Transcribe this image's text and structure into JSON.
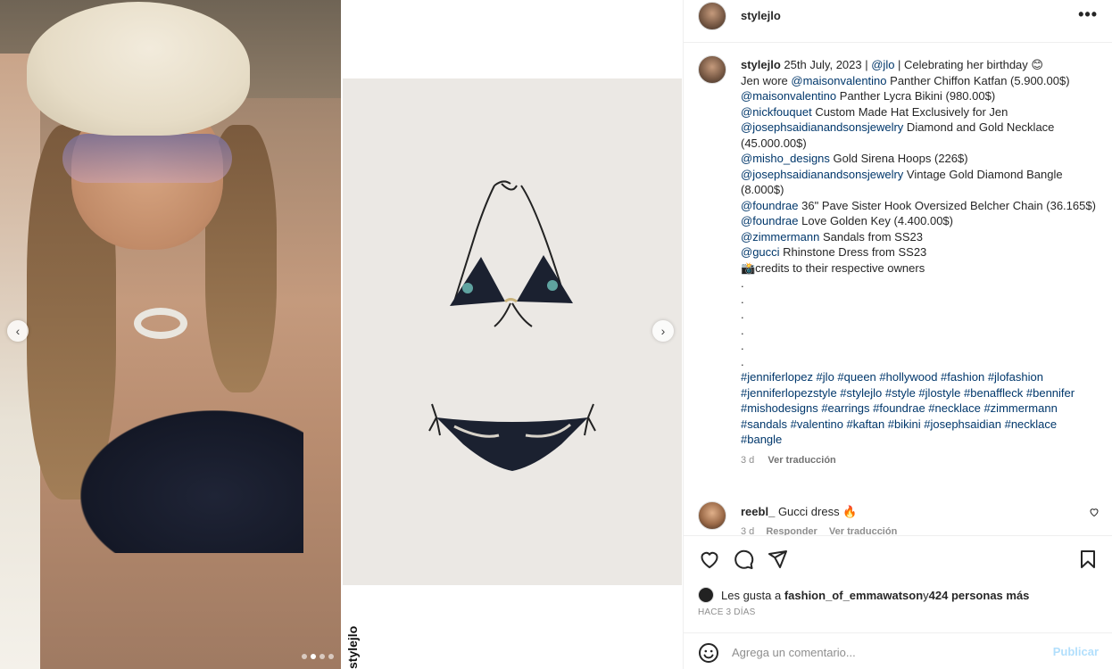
{
  "post": {
    "username": "stylejlo",
    "more_label": "•••"
  },
  "caption": {
    "username": "stylejlo",
    "line1_text": " 25th July, 2023 | ",
    "line1_mention": "@jlo",
    "line1_tail": " | Celebrating her birthday 😊",
    "lines": [
      {
        "prefix": "Jen wore ",
        "mention": "@maisonvalentino",
        "text": " Panther Chiffon Katfan (5.900.00$)"
      },
      {
        "prefix": "",
        "mention": "@maisonvalentino",
        "text": " Panther Lycra Bikini (980.00$)"
      },
      {
        "prefix": "",
        "mention": "@nickfouquet",
        "text": " Custom Made Hat Exclusively for Jen"
      },
      {
        "prefix": "",
        "mention": "@josephsaidianandsonsjewelry",
        "text": " Diamond and Gold Necklace (45.000.00$)"
      },
      {
        "prefix": "",
        "mention": "@misho_designs",
        "text": " Gold Sirena Hoops (226$)"
      },
      {
        "prefix": "",
        "mention": "@josephsaidianandsonsjewelry",
        "text": " Vintage Gold Diamond Bangle (8.000$)"
      },
      {
        "prefix": "",
        "mention": "@foundrae",
        "text": " 36\" Pave Sister Hook Oversized Belcher Chain (36.165$)"
      },
      {
        "prefix": "",
        "mention": "@foundrae",
        "text": " Love Golden Key (4.400.00$)"
      },
      {
        "prefix": "",
        "mention": "@zimmermann",
        "text": " Sandals from SS23"
      },
      {
        "prefix": "",
        "mention": "@gucci",
        "text": " Rhinstone Dress from SS23"
      }
    ],
    "credits": "📸credits to their respective owners",
    "dots": [
      ".",
      ".",
      ".",
      ".",
      ".",
      "."
    ],
    "hashtags": "#jenniferlopez #jlo #queen #hollywood #fashion #jlofashion #jenniferlopezstyle #stylejlo #style #jlostyle #benaffleck #bennifer #mishodesigns #earrings #foundrae #necklace #zimmermann #sandals #valentino #kaftan #bikini #josephsaidian #necklace #bangle",
    "time": "3 d",
    "translate": "Ver traducción"
  },
  "comment": {
    "username": "reebl_",
    "text": "Gucci dress 🔥",
    "time": "3 d",
    "reply": "Responder",
    "translate": "Ver traducción"
  },
  "likes": {
    "prefix": "Les gusta a ",
    "user": "fashion_of_emmawatson",
    "middle": " y ",
    "count": "424 personas más"
  },
  "date_ago": "HACE 3 DÍAS",
  "add_comment": {
    "placeholder": "Agrega un comentario...",
    "post_label": "Publicar"
  },
  "media": {
    "watermark": "stylejlo",
    "prev_icon": "‹",
    "next_icon": "›",
    "slide_count": 4,
    "active_slide": 2
  }
}
